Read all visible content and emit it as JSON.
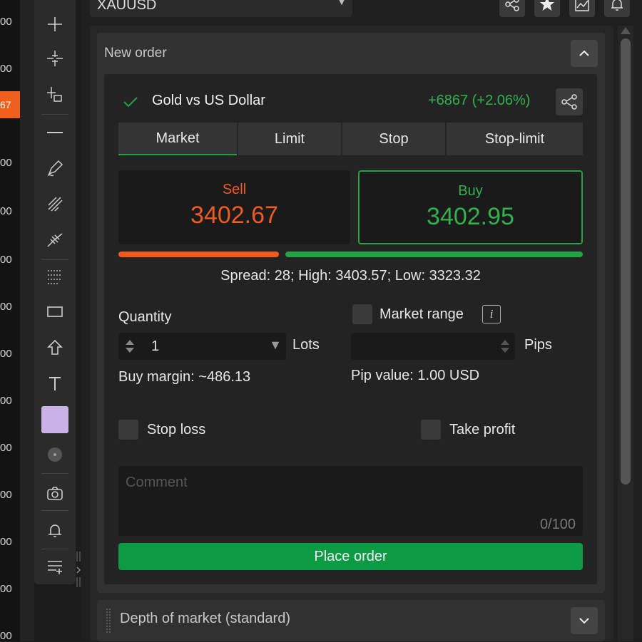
{
  "price_axis": {
    "tick_label": "00",
    "current_badge": "67"
  },
  "symbol": {
    "value": "XAUUSD"
  },
  "toolbar": {
    "tools": [
      "crosshair-icon",
      "cross-cursor-icon",
      "cursor-icon",
      "horizontal-line-icon",
      "pen-icon",
      "fib-icon",
      "pitchfork-icon",
      "fib-time-icon",
      "rectangle-icon",
      "arrow-up-icon",
      "text-icon",
      "color-swatch",
      "circle-icon",
      "camera-icon",
      "bell-icon",
      "template-icon"
    ],
    "swatch_color": "#c9b3e6"
  },
  "new_order": {
    "title": "New order",
    "instrument": "Gold vs US Dollar",
    "change": "+6867 (+2.06%)",
    "tabs": [
      {
        "label": "Market",
        "active": true
      },
      {
        "label": "Limit",
        "active": false
      },
      {
        "label": "Stop",
        "active": false
      },
      {
        "label": "Stop-limit",
        "active": false
      }
    ],
    "sell": {
      "label": "Sell",
      "price": "3402.67",
      "color": "#f05a1e"
    },
    "buy": {
      "label": "Buy",
      "price": "3402.95",
      "color": "#1fa343"
    },
    "spread_info": "Spread: 28; High: 3403.57; Low: 3323.32",
    "quantity": {
      "label": "Quantity",
      "value": "1",
      "unit": "Lots"
    },
    "buy_margin": "Buy margin: ~486.13",
    "market_range": {
      "label": "Market range",
      "info": "i",
      "unit": "Pips",
      "value": ""
    },
    "pip_value": "Pip value: 1.00 USD",
    "stop_loss": "Stop loss",
    "take_profit": "Take profit",
    "comment": {
      "placeholder": "Comment",
      "counter": "0/100"
    },
    "place_order": "Place order"
  },
  "depth": {
    "title": "Depth of market (standard)"
  }
}
